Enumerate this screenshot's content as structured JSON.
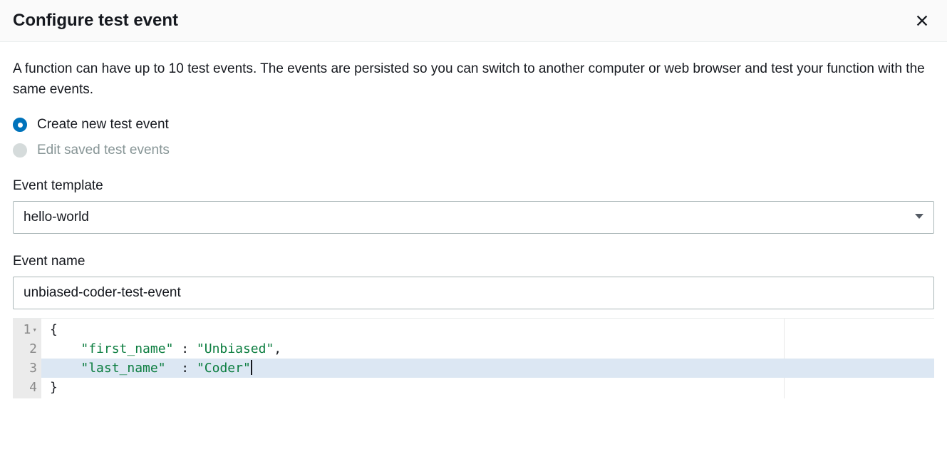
{
  "dialog": {
    "title": "Configure test event",
    "description": "A function can have up to 10 test events. The events are persisted so you can switch to another computer or web browser and test your function with the same events."
  },
  "radio": {
    "create_label": "Create new test event",
    "edit_label": "Edit saved test events"
  },
  "template": {
    "label": "Event template",
    "value": "hello-world"
  },
  "event_name": {
    "label": "Event name",
    "value": "unbiased-coder-test-event"
  },
  "code": {
    "line_numbers": [
      "1",
      "2",
      "3",
      "4"
    ],
    "line1_bracket": "{",
    "line2_key": "\"first_name\"",
    "line2_sep": " : ",
    "line2_val": "\"Unbiased\"",
    "line2_comma": ",",
    "line3_key": "\"last_name\"",
    "line3_sep": "  : ",
    "line3_val": "\"Coder\"",
    "line4_bracket": "}"
  }
}
